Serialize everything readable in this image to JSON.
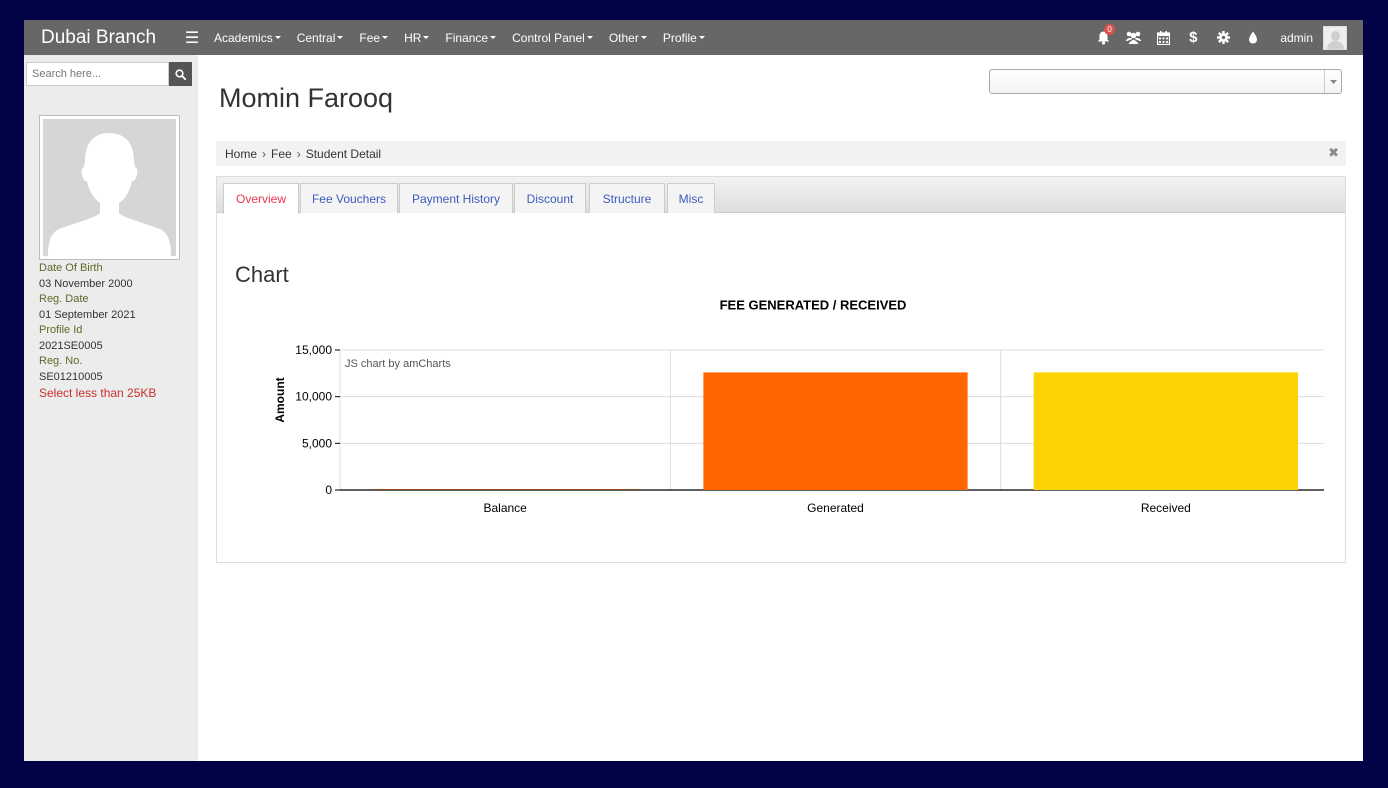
{
  "navbar": {
    "brand": "Dubai Branch",
    "menu": [
      "Academics",
      "Central",
      "Fee",
      "HR",
      "Finance",
      "Control Panel",
      "Other",
      "Profile"
    ],
    "notification_count": "0",
    "user": "admin"
  },
  "sidebar": {
    "search_placeholder": "Search here...",
    "info": [
      {
        "label": "Date Of Birth",
        "value": "03 November 2000"
      },
      {
        "label": "Reg. Date",
        "value": "01 September 2021"
      },
      {
        "label": "Profile Id",
        "value": "2021SE0005"
      },
      {
        "label": "Reg. No.",
        "value": "SE01210005"
      }
    ],
    "upload_warning": "Select less than 25KB"
  },
  "main": {
    "student_name": "Momin Farooq",
    "breadcrumb": [
      "Home",
      "Fee",
      "Student Detail"
    ],
    "tabs": [
      "Overview",
      "Fee Vouchers",
      "Payment History",
      "Discount",
      "Structure",
      "Misc"
    ],
    "active_tab": "Overview",
    "section_title": "Chart"
  },
  "chart_data": {
    "type": "bar",
    "title": "FEE GENERATED / RECEIVED",
    "ylabel": "Amount",
    "xlabel": "",
    "credit": "JS chart by amCharts",
    "categories": [
      "Balance",
      "Generated",
      "Received"
    ],
    "values": [
      0,
      12600,
      12600
    ],
    "colors": [
      "#b0de09",
      "#ff6600",
      "#fcd202"
    ],
    "ylim": [
      0,
      15000
    ],
    "yticks": [
      0,
      5000,
      10000,
      15000
    ],
    "ytick_labels": [
      "0",
      "5,000",
      "10,000",
      "15,000"
    ],
    "grid": true,
    "legend": [
      {
        "name": "Generated",
        "color": "#ff6600"
      },
      {
        "name": "Received",
        "color": "#fcd202"
      },
      {
        "name": "Balance",
        "color": "#b0de09"
      }
    ],
    "legend_position": "bottom-left"
  }
}
